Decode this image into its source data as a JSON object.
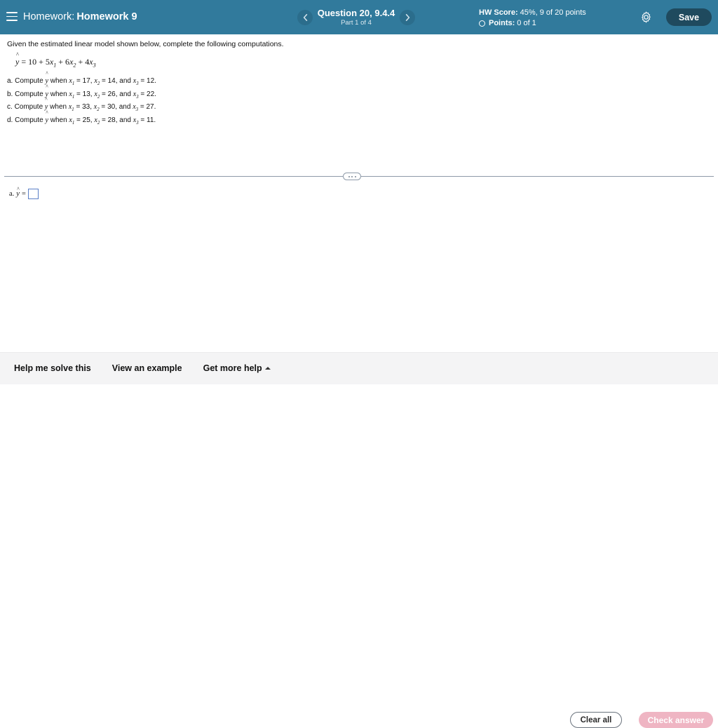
{
  "header": {
    "menu_icon": "hamburger-icon",
    "label": "Homework:",
    "title": "Homework 9",
    "nav": {
      "prev_icon": "chevron-left-icon",
      "next_icon": "chevron-right-icon",
      "question_title": "Question 20, 9.4.4",
      "part_label": "Part 1 of 4"
    },
    "score": {
      "hw_score_label": "HW Score:",
      "hw_score_value": "45%, 9 of 20 points",
      "points_label": "Points:",
      "points_value": "0 of 1",
      "points_icon": "circle-outline-icon"
    },
    "settings_icon": "gear-icon",
    "save_label": "Save",
    "background_color": "#317a9c",
    "save_color": "#1f4a5e"
  },
  "problem": {
    "prompt": "Given the estimated linear model shown below, complete the following computations.",
    "equation": {
      "lhs": "y",
      "rhs_text": "= 10 + 5x1 + 6x2 + 4x3",
      "intercept": 10,
      "coefficients": [
        5,
        6,
        4
      ]
    },
    "parts": [
      {
        "letter": "a.",
        "text_pre": "Compute",
        "text_mid": "when",
        "x1": "17",
        "x2": "14",
        "x3": "12."
      },
      {
        "letter": "b.",
        "text_pre": "Compute",
        "text_mid": "when",
        "x1": "13",
        "x2": "26",
        "x3": "22."
      },
      {
        "letter": "c.",
        "text_pre": "Compute",
        "text_mid": "when",
        "x1": "33",
        "x2": "30",
        "x3": "27."
      },
      {
        "letter": "d.",
        "text_pre": "Compute",
        "text_mid": "when",
        "x1": "25",
        "x2": "28",
        "x3": "11."
      }
    ],
    "divider_handle_icon": "ellipsis-collapse-handle"
  },
  "answer": {
    "letter": "a.",
    "equals": "=",
    "value": "",
    "placeholder": ""
  },
  "footer": {
    "links": [
      {
        "label": "Help me solve this",
        "has_caret": false
      },
      {
        "label": "View an example",
        "has_caret": false
      },
      {
        "label": "Get more help",
        "has_caret": true
      }
    ],
    "clear_all_label": "Clear all",
    "check_answer_label": "Check answer",
    "check_answer_color": "#efb5c3"
  }
}
